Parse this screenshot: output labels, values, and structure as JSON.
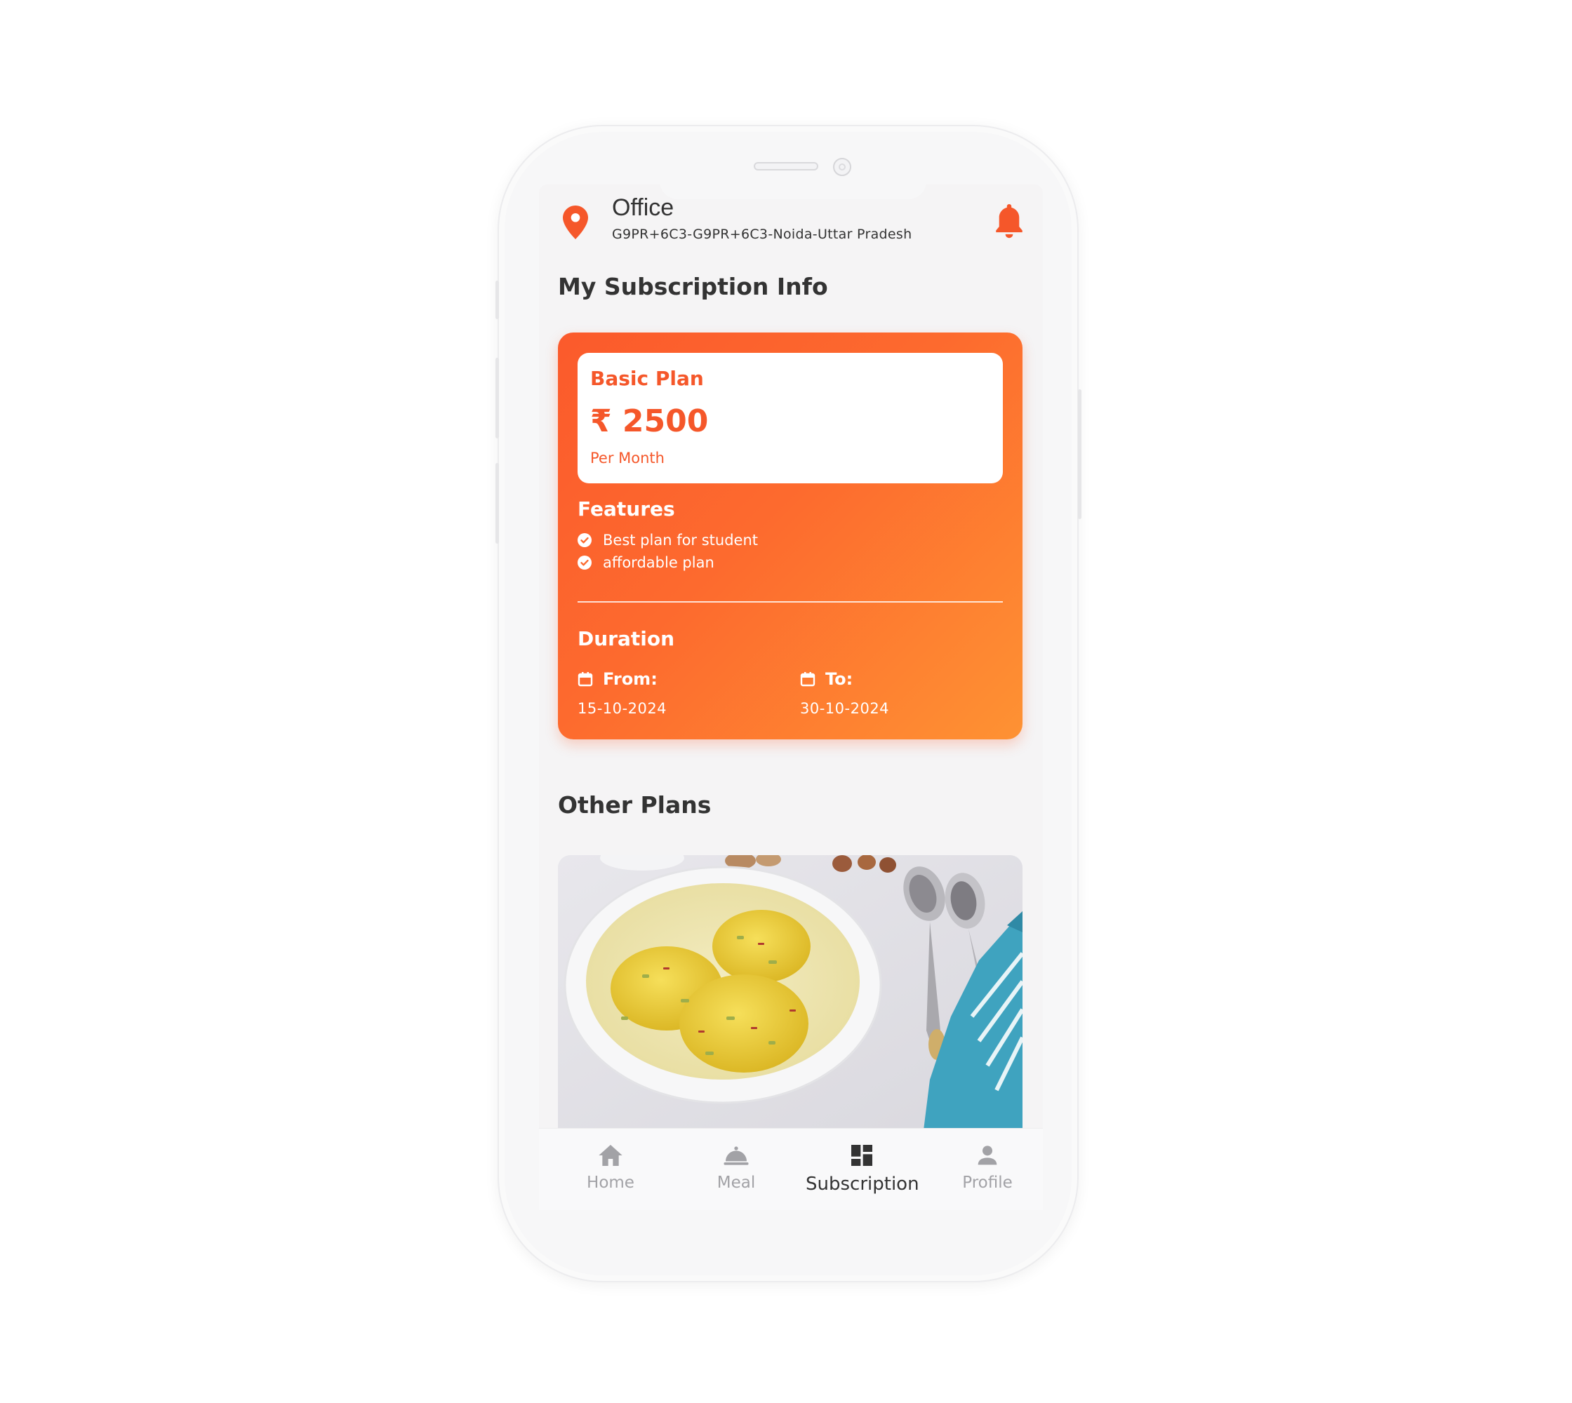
{
  "header": {
    "location_title": "Office",
    "location_address": "G9PR+6C3-G9PR+6C3-Noida-Uttar Pradesh",
    "pin_icon": "map-pin-icon",
    "bell_icon": "notification-bell-icon"
  },
  "subscription": {
    "section_title": "My Subscription Info",
    "plan_name": "Basic Plan",
    "price": "₹ 2500",
    "period": "Per Month",
    "features_title": "Features",
    "features": [
      "Best plan for student",
      "affordable plan"
    ],
    "duration_title": "Duration",
    "from_label": "From:",
    "from_date": "15-10-2024",
    "to_label": "To:",
    "to_date": "30-10-2024"
  },
  "other_plans": {
    "section_title": "Other Plans"
  },
  "nav": {
    "items": [
      {
        "label": "Home",
        "icon": "home-icon"
      },
      {
        "label": "Meal",
        "icon": "meal-cloche-icon"
      },
      {
        "label": "Subscription",
        "icon": "dashboard-icon"
      },
      {
        "label": "Profile",
        "icon": "person-icon"
      }
    ],
    "active": "Subscription"
  },
  "colors": {
    "accent": "#f5572a",
    "gradient_start": "#fb5a2c",
    "gradient_end": "#fe9233",
    "nav_inactive": "#a2a2a6",
    "text_dark": "#333333"
  }
}
